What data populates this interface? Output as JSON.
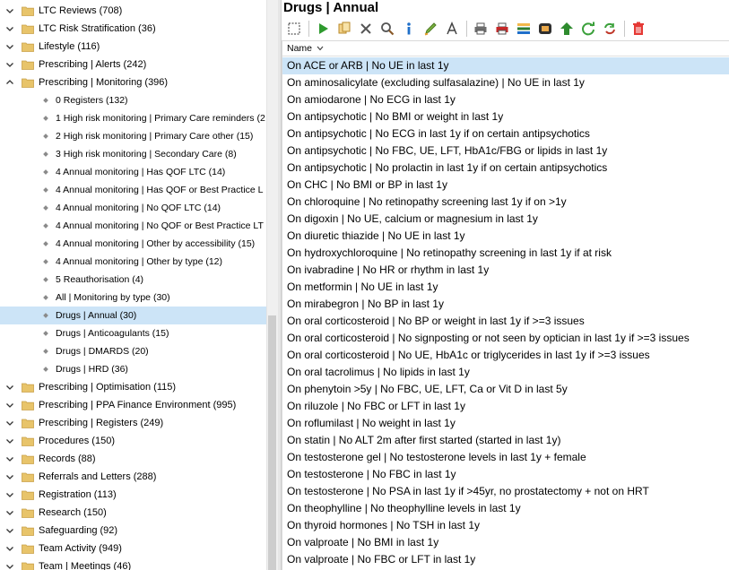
{
  "tree": {
    "items": [
      {
        "label": "LTC Reviews (708)",
        "type": "folder",
        "expanded": false
      },
      {
        "label": "LTC Risk Stratification (36)",
        "type": "folder",
        "expanded": false
      },
      {
        "label": "Lifestyle (116)",
        "type": "folder",
        "expanded": false
      },
      {
        "label": "Prescribing | Alerts (242)",
        "type": "folder",
        "expanded": false
      },
      {
        "label": "Prescribing | Monitoring (396)",
        "type": "folder",
        "expanded": true
      },
      {
        "label": "0 Registers (132)",
        "type": "child"
      },
      {
        "label": "1 High risk monitoring | Primary Care reminders (2",
        "type": "child"
      },
      {
        "label": "2 High risk monitoring | Primary Care other (15)",
        "type": "child"
      },
      {
        "label": "3 High risk monitoring | Secondary Care (8)",
        "type": "child"
      },
      {
        "label": "4 Annual monitoring | Has QOF LTC (14)",
        "type": "child"
      },
      {
        "label": "4 Annual monitoring | Has QOF or Best Practice L",
        "type": "child"
      },
      {
        "label": "4 Annual monitoring | No QOF LTC (14)",
        "type": "child"
      },
      {
        "label": "4 Annual monitoring | No QOF or Best Practice LT",
        "type": "child"
      },
      {
        "label": "4 Annual monitoring | Other by accessibility (15)",
        "type": "child"
      },
      {
        "label": "4 Annual monitoring | Other by type (12)",
        "type": "child"
      },
      {
        "label": "5 Reauthorisation (4)",
        "type": "child"
      },
      {
        "label": "All | Monitoring by type (30)",
        "type": "child"
      },
      {
        "label": "Drugs | Annual (30)",
        "type": "child",
        "selected": true
      },
      {
        "label": "Drugs | Anticoagulants (15)",
        "type": "child"
      },
      {
        "label": "Drugs | DMARDS (20)",
        "type": "child"
      },
      {
        "label": "Drugs | HRD (36)",
        "type": "child"
      },
      {
        "label": "Prescribing | Optimisation (115)",
        "type": "folder",
        "expanded": false
      },
      {
        "label": "Prescribing | PPA Finance Environment (995)",
        "type": "folder",
        "expanded": false
      },
      {
        "label": "Prescribing | Registers (249)",
        "type": "folder",
        "expanded": false
      },
      {
        "label": "Procedures (150)",
        "type": "folder",
        "expanded": false
      },
      {
        "label": "Records (88)",
        "type": "folder",
        "expanded": false
      },
      {
        "label": "Referrals and Letters (288)",
        "type": "folder",
        "expanded": false
      },
      {
        "label": "Registration (113)",
        "type": "folder",
        "expanded": false
      },
      {
        "label": "Research (150)",
        "type": "folder",
        "expanded": false
      },
      {
        "label": "Safeguarding (92)",
        "type": "folder",
        "expanded": false
      },
      {
        "label": "Team Activity (949)",
        "type": "folder",
        "expanded": false
      },
      {
        "label": "Team | Meetings (46)",
        "type": "folder",
        "expanded": false
      }
    ]
  },
  "panel": {
    "title": "Drugs | Annual",
    "toolbar": [
      "select-icon",
      "run-icon",
      "copy-icon",
      "delete-icon",
      "search-icon",
      "info-icon",
      "edit-icon",
      "font-icon",
      "print-icon",
      "print-preview-icon",
      "export-icon",
      "database-icon",
      "move-up-icon",
      "refresh-icon",
      "sync-icon",
      "trash-icon"
    ],
    "column_header": "Name",
    "rows": [
      "On ACE or ARB | No UE in last 1y",
      "On aminosalicylate (excluding sulfasalazine) | No UE in last 1y",
      "On amiodarone | No ECG in last 1y",
      "On antipsychotic | No BMI or weight in last 1y",
      "On antipsychotic | No ECG in last 1y if on certain antipsychotics",
      "On antipsychotic | No FBC, UE, LFT, HbA1c/FBG or lipids in last 1y",
      "On antipsychotic | No prolactin in last 1y if on certain antipsychotics",
      "On CHC | No BMI or BP in last 1y",
      "On chloroquine | No retinopathy screening last 1y if on >1y",
      "On digoxin | No UE, calcium or magnesium in last 1y",
      "On diuretic thiazide | No UE in last 1y",
      "On hydroxychloroquine | No retinopathy screening in last 1y if at risk",
      "On ivabradine | No HR or rhythm in last 1y",
      "On metformin | No UE in last 1y",
      "On mirabegron | No BP in last 1y",
      "On oral corticosteroid | No BP or weight in last 1y if >=3 issues",
      "On oral corticosteroid | No signposting or not seen by optician in last 1y if >=3 issues",
      "On oral corticosteroid | No UE, HbA1c or triglycerides in last 1y if >=3 issues",
      "On oral tacrolimus | No lipids in last 1y",
      "On phenytoin >5y | No FBC, UE, LFT, Ca or Vit D in last 5y",
      "On riluzole | No FBC or LFT in last 1y",
      "On roflumilast | No weight in last 1y",
      "On statin | No ALT 2m after first started (started in last 1y)",
      "On testosterone gel | No testosterone levels in last 1y + female",
      "On testosterone | No FBC in last 1y",
      "On testosterone | No PSA in last 1y if >45yr, no prostatectomy + not on HRT",
      "On theophylline | No theophylline levels in last 1y",
      "On thyroid hormones | No TSH in last 1y",
      "On valproate | No BMI in last 1y",
      "On valproate | No FBC or LFT in last 1y"
    ],
    "selected_row": 0
  },
  "colors": {
    "selection": "#cce4f7",
    "folder": "#e8c46a",
    "accent": "#2e7d32"
  }
}
